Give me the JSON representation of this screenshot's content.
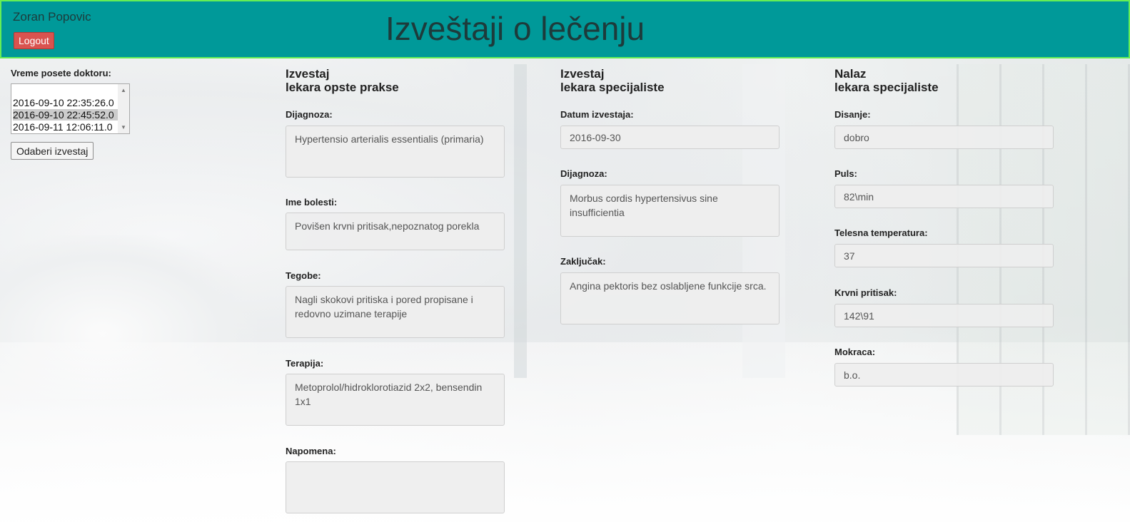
{
  "header": {
    "user_name": "Zoran Popovic",
    "logout_label": "Logout",
    "title": "Izveštaji o lečenju"
  },
  "visits": {
    "label": "Vreme posete doktoru:",
    "options": [
      "2016-09-10 22:35:26.0",
      "2016-09-10 22:45:52.0",
      "2016-09-11 12:06:11.0"
    ],
    "selected": "2016-09-10 22:45:52.0",
    "select_button": "Odaberi izvestaj"
  },
  "gp_report": {
    "title_line1": "Izvestaj",
    "title_line2": "lekara opste prakse",
    "diagnosis_label": "Dijagnoza:",
    "diagnosis": "Hypertensio arterialis essentialis (primaria)",
    "disease_label": "Ime bolesti:",
    "disease": "Povišen krvni pritisak,nepoznatog porekla",
    "complaints_label": "Tegobe:",
    "complaints": "Nagli skokovi pritiska i pored propisane i redovno uzimane terapije",
    "therapy_label": "Terapija:",
    "therapy": "Metoprolol/hidroklorotiazid 2x2, bensendin 1x1",
    "note_label": "Napomena:",
    "note": ""
  },
  "specialist_report": {
    "title_line1": "Izvestaj",
    "title_line2": "lekara specijaliste",
    "date_label": "Datum izvestaja:",
    "date": "2016-09-30",
    "diagnosis_label": "Dijagnoza:",
    "diagnosis": "Morbus cordis hypertensivus sine insufficientia",
    "conclusion_label": "Zaključak:",
    "conclusion": "Angina pektoris bez oslabljene funkcije srca."
  },
  "specialist_findings": {
    "title_line1": "Nalaz",
    "title_line2": "lekara specijaliste",
    "breathing_label": "Disanje:",
    "breathing": "dobro",
    "pulse_label": "Puls:",
    "pulse": "82\\min",
    "temperature_label": "Telesna temperatura:",
    "temperature": "37",
    "blood_pressure_label": "Krvni pritisak:",
    "blood_pressure": "142\\91",
    "urine_label": "Mokraca:",
    "urine": "b.o."
  }
}
